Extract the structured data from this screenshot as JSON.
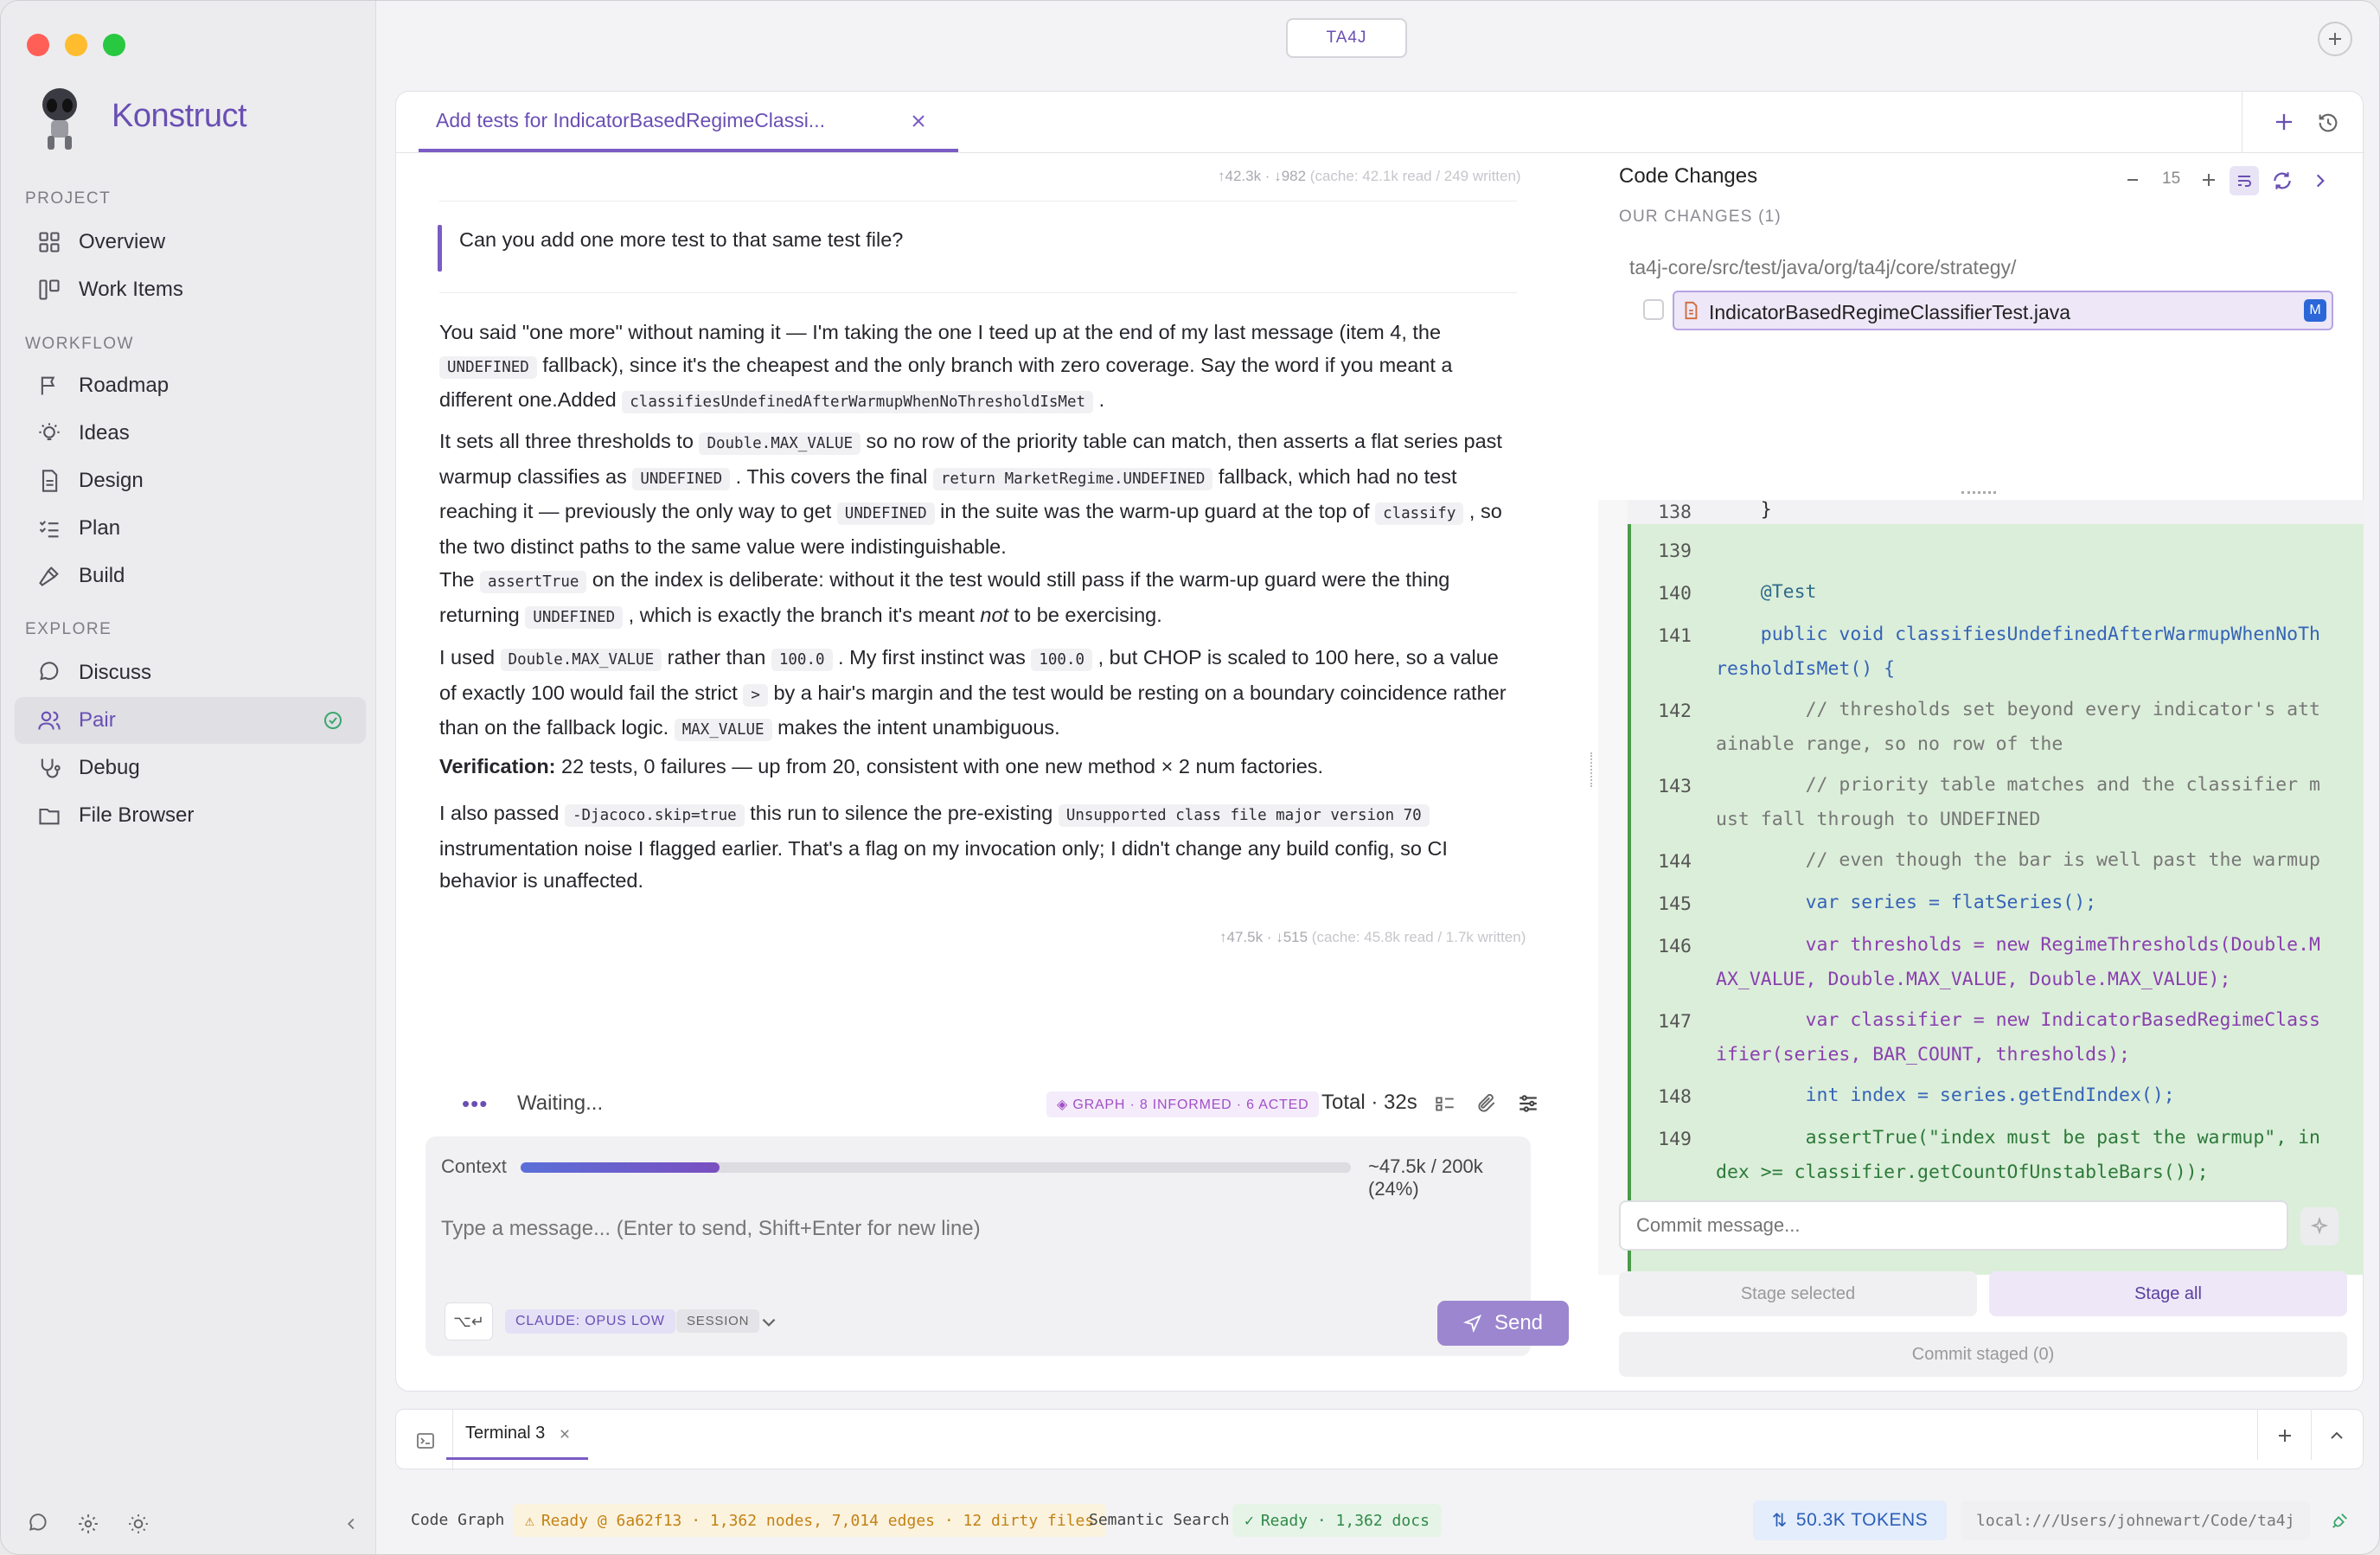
{
  "app": {
    "name": "Konstruct",
    "project_badge": "TA4J"
  },
  "sidebar": {
    "sections": [
      {
        "label": "PROJECT",
        "items": [
          {
            "label": "Overview",
            "icon": "grid-icon"
          },
          {
            "label": "Work Items",
            "icon": "kanban-icon"
          }
        ]
      },
      {
        "label": "WORKFLOW",
        "items": [
          {
            "label": "Roadmap",
            "icon": "flag-icon"
          },
          {
            "label": "Ideas",
            "icon": "lightbulb-icon"
          },
          {
            "label": "Design",
            "icon": "document-icon"
          },
          {
            "label": "Plan",
            "icon": "checklist-icon"
          },
          {
            "label": "Build",
            "icon": "hammer-icon"
          }
        ]
      },
      {
        "label": "EXPLORE",
        "items": [
          {
            "label": "Discuss",
            "icon": "chat-bubble-icon"
          },
          {
            "label": "Pair",
            "icon": "users-icon",
            "active": true
          },
          {
            "label": "Debug",
            "icon": "stethoscope-icon"
          },
          {
            "label": "File Browser",
            "icon": "folder-icon"
          }
        ]
      }
    ]
  },
  "tab": {
    "title": "Add tests for IndicatorBasedRegimeClassi..."
  },
  "chat": {
    "tokens_top": "↑42.3k · ↓982",
    "tokens_top_cache": "(cache: 42.1k read / 249 written)",
    "user_message": "Can you add one more test to that same test file?",
    "p1": {
      "a": "You said \"one more\" without naming it — I'm taking the one I teed up at the end of my last message (item 4, the ",
      "c1": "UNDEFINED",
      "b": " fallback), since it's the cheapest and the only branch with zero coverage. Say the word if you meant a different one.Added ",
      "c2": "classifiesUndefinedAfterWarmupWhenNoThresholdIsMet",
      "d": " ."
    },
    "p2": {
      "a": "It sets all three thresholds to ",
      "c1": "Double.MAX_VALUE",
      "b": " so no row of the priority table can match, then asserts a flat series past warmup classifies as ",
      "c2": "UNDEFINED",
      "c": " . This covers the final ",
      "c3": "return MarketRegime.UNDEFINED",
      "d": " fallback, which had no test reaching it — previously the only way to get ",
      "c4": "UNDEFINED",
      "e": " in the suite was the warm-up guard at the top of ",
      "c5": "classify",
      "f": " , so the two distinct paths to the same value were indistinguishable."
    },
    "p3": {
      "a": "The ",
      "c1": "assertTrue",
      "b": " on the index is deliberate: without it the test would still pass if the warm-up guard were the thing returning ",
      "c2": "UNDEFINED",
      "c": " , which is exactly the branch it's meant ",
      "em": "not",
      "d": " to be exercising."
    },
    "p4": {
      "a": "I used ",
      "c1": "Double.MAX_VALUE",
      "b": " rather than ",
      "c2": "100.0",
      "c": " . My first instinct was ",
      "c3": "100.0",
      "d": " , but CHOP is scaled to 100 here, so a value of exactly 100 would fail the strict ",
      "c4": ">",
      "e": " by a hair's margin and the test would be resting on a boundary coincidence rather than on the fallback logic. ",
      "c5": "MAX_VALUE",
      "f": " makes the intent unambiguous."
    },
    "p5": {
      "strong": "Verification:",
      "a": " 22 tests, 0 failures — up from 20, consistent with one new method × 2 num factories."
    },
    "p6": {
      "a": "I also passed ",
      "c1": "-Djacoco.skip=true",
      "b": " this run to silence the pre-existing ",
      "c2": "Unsupported class file major version 70",
      "c": " instrumentation noise I flagged earlier. That's a flag on my invocation only; I didn't change any build config, so CI behavior is unaffected."
    },
    "tokens_bottom": "↑47.5k · ↓515",
    "tokens_bottom_cache": "(cache: 45.8k read / 1.7k written)",
    "status": "Waiting...",
    "graph_badge": "◈ GRAPH · 8 INFORMED · 6 ACTED",
    "total": "Total · 32s",
    "context_label": "Context",
    "context_fraction": 0.24,
    "context_value": "~47.5k / 200k (24%)",
    "input_placeholder": "Type a message... (Enter to send, Shift+Enter for new line)",
    "shortcut": "⌥↵",
    "model_badge": "CLAUDE: OPUS LOW",
    "session_badge": "SESSION",
    "send_label": "Send"
  },
  "changes": {
    "title": "Code Changes",
    "context_lines": "15",
    "our_changes": "OUR CHANGES (1)",
    "path": "ta4j-core/src/test/java/org/ta4j/core/strategy/",
    "file": "IndicatorBasedRegimeClassifierTest.java",
    "file_status": "M",
    "commit_placeholder": "Commit message...",
    "stage_selected": "Stage selected",
    "stage_all": "Stage all",
    "commit_staged": "Commit staged (0)"
  },
  "code_lines": [
    {
      "n": "138",
      "text": "    }"
    },
    {
      "n": "139",
      "text": ""
    },
    {
      "n": "140",
      "text": "    @Test"
    },
    {
      "n": "141",
      "text": "    public void classifiesUndefinedAfterWarmupWhenNoThresholdIsMet() {"
    },
    {
      "n": "142",
      "text": "        // thresholds set beyond every indicator's attainable range, so no row of the"
    },
    {
      "n": "143",
      "text": "        // priority table matches and the classifier must fall through to UNDEFINED"
    },
    {
      "n": "144",
      "text": "        // even though the bar is well past the warmup"
    },
    {
      "n": "145",
      "text": "        var series = flatSeries();"
    },
    {
      "n": "146",
      "text": "        var thresholds = new RegimeThresholds(Double.MAX_VALUE, Double.MAX_VALUE, Double.MAX_VALUE);"
    },
    {
      "n": "147",
      "text": "        var classifier = new IndicatorBasedRegimeClassifier(series, BAR_COUNT, thresholds);"
    },
    {
      "n": "148",
      "text": "        int index = series.getEndIndex();"
    },
    {
      "n": "149",
      "text": "        assertTrue(\"index must be past the warmup\", index >= classifier.getCountOfUnstableBars());"
    }
  ],
  "terminal": {
    "tab": "Terminal 3"
  },
  "statusbar": {
    "code_graph_label": "Code Graph",
    "code_graph_status": "Ready @ 6a62f13 · 1,362 nodes, 7,014 edges · 12 dirty files",
    "semantic_label": "Semantic Search",
    "semantic_status": "Ready · 1,362 docs",
    "tokens": "50.3K TOKENS",
    "path": "local:///Users/johnewart/Code/ta4j"
  },
  "colors": {
    "accent": "#6a4fb3",
    "diff_bg": "#dbeed9",
    "diff_bar": "#4c9a4a"
  }
}
